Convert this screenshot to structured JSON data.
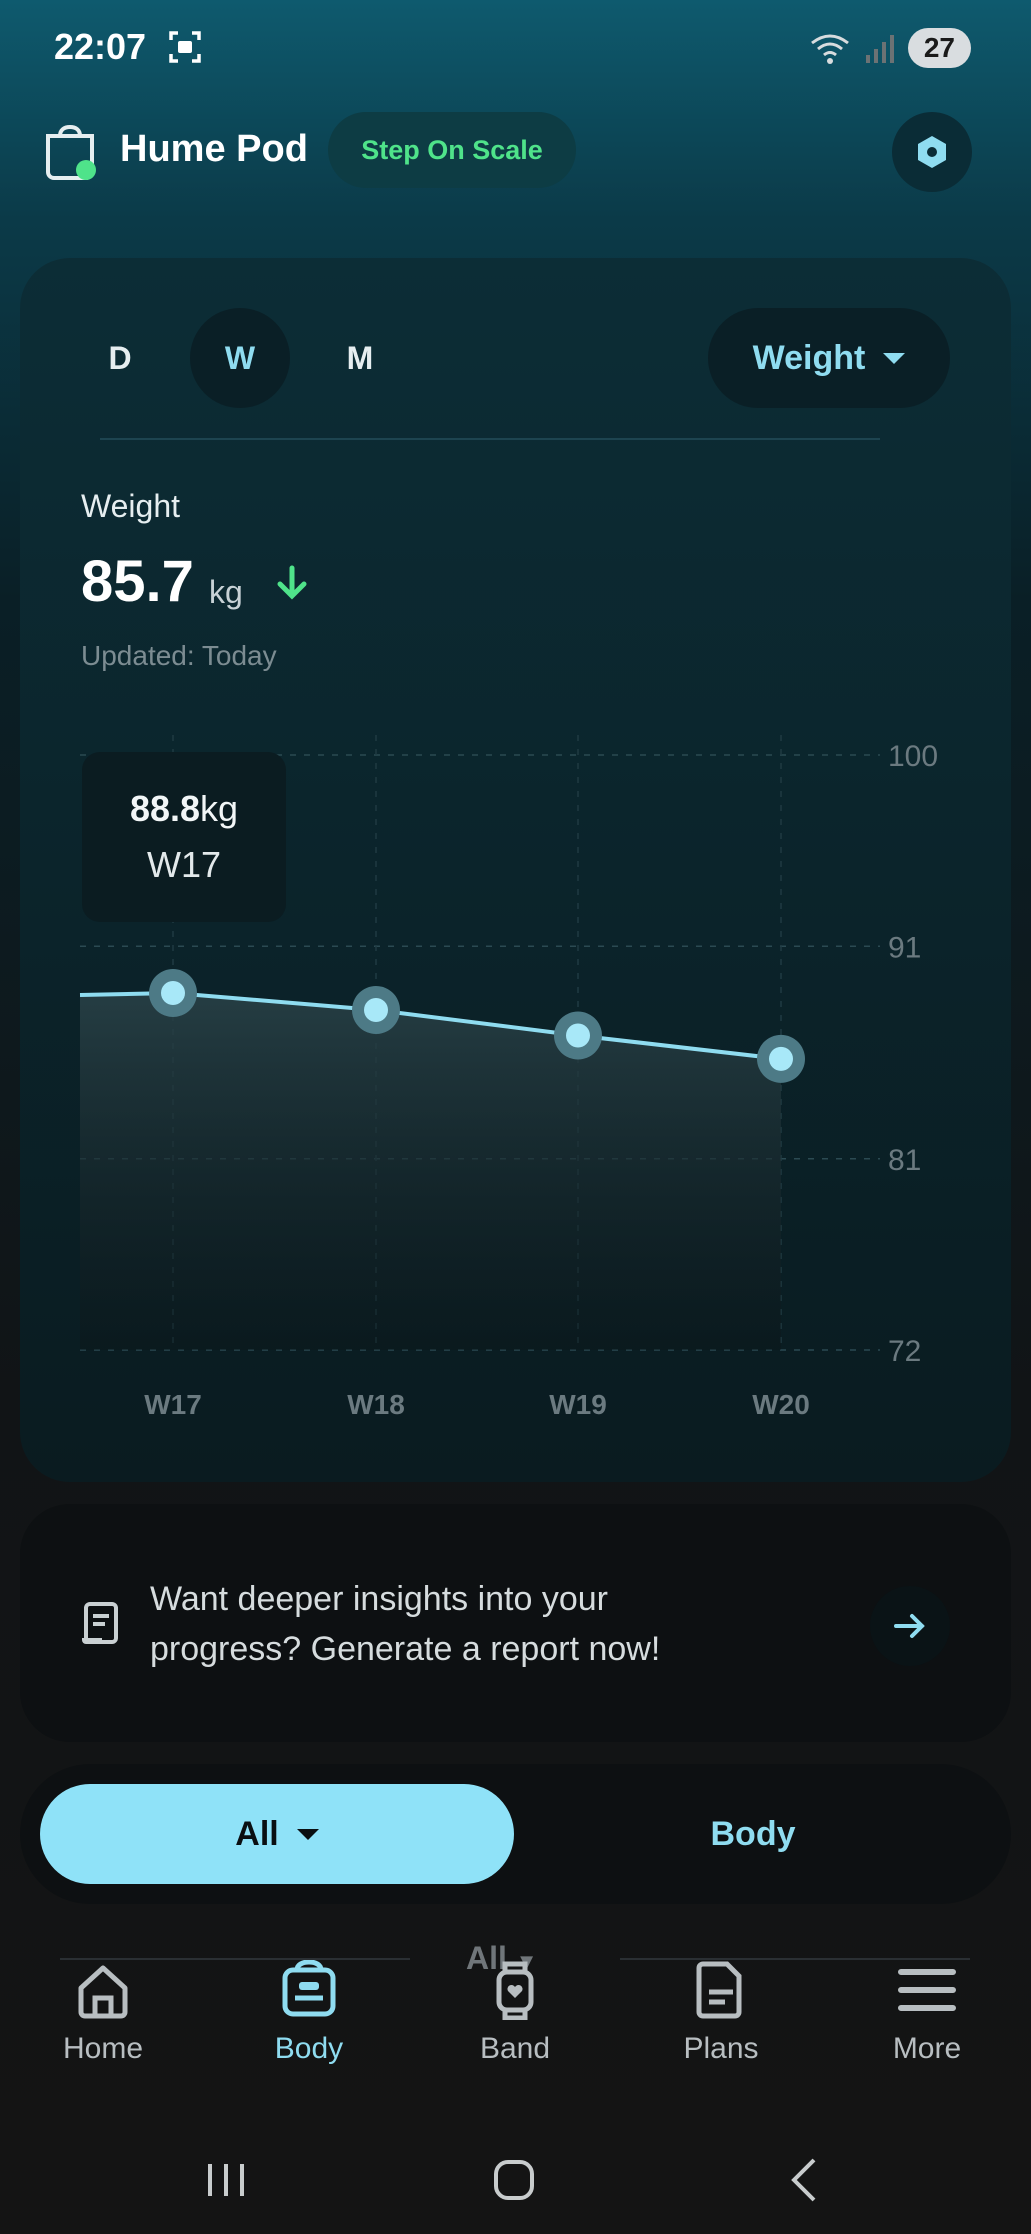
{
  "status": {
    "time": "22:07",
    "battery": "27"
  },
  "header": {
    "device_name": "Hume Pod",
    "step_on_scale": "Step On Scale"
  },
  "period_tabs": [
    {
      "label": "D",
      "active": false
    },
    {
      "label": "W",
      "active": true
    },
    {
      "label": "M",
      "active": false
    }
  ],
  "metric_dropdown": {
    "label": "Weight"
  },
  "summary": {
    "label": "Weight",
    "value": "85.7",
    "unit": "kg",
    "updated": "Updated: Today"
  },
  "tooltip": {
    "value": "88.8",
    "unit": "kg",
    "label": "W17"
  },
  "chart_data": {
    "type": "line",
    "x": [
      "W17",
      "W18",
      "W19",
      "W20"
    ],
    "series": [
      {
        "values": [
          88.8,
          88.0,
          86.8,
          85.7
        ]
      }
    ],
    "y_ticks": [
      "100",
      "91",
      "81",
      "72"
    ],
    "ylim": [
      72,
      100
    ],
    "grid": true
  },
  "insights": {
    "text": "Want deeper insights into your progress? Generate a report now!"
  },
  "segmented": {
    "all_label": "All",
    "body_label": "Body"
  },
  "ghost": {
    "label": "All"
  },
  "nav": [
    {
      "label": "Home",
      "icon": "home-icon"
    },
    {
      "label": "Body",
      "icon": "scale-icon"
    },
    {
      "label": "Band",
      "icon": "watch-icon"
    },
    {
      "label": "Plans",
      "icon": "document-icon"
    },
    {
      "label": "More",
      "icon": "menu-icon"
    }
  ],
  "colors": {
    "accent": "#8fdcf0",
    "green": "#4fe38a"
  }
}
